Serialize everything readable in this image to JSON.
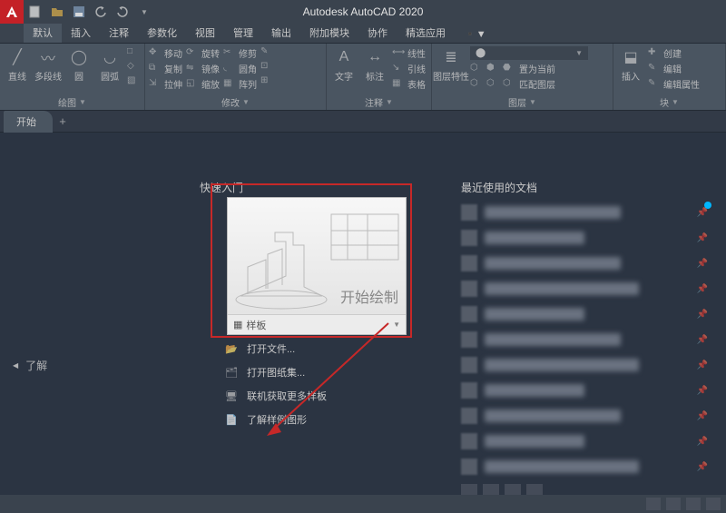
{
  "title": "Autodesk AutoCAD 2020",
  "ribbon_tabs": [
    "默认",
    "插入",
    "注释",
    "参数化",
    "视图",
    "管理",
    "输出",
    "附加模块",
    "协作",
    "精选应用"
  ],
  "active_ribbon_tab": 0,
  "panels": {
    "draw": {
      "title": "绘图",
      "btns": [
        "直线",
        "多段线",
        "圆",
        "圆弧"
      ]
    },
    "modify": {
      "title": "修改",
      "btns": [
        "移动",
        "复制",
        "拉伸"
      ],
      "small": [
        "旋转",
        "镜像",
        "缩放",
        "修剪",
        "圆角",
        "阵列"
      ]
    },
    "annotate": {
      "title": "注释",
      "btns": [
        "文字",
        "标注"
      ],
      "small": [
        "线性",
        "引线",
        "表格"
      ]
    },
    "layer": {
      "title": "图层",
      "btns": [
        "图层特性"
      ],
      "small": [
        "置为当前",
        "匹配图层"
      ]
    },
    "block": {
      "title": "块",
      "btns": [
        "插入"
      ],
      "small": [
        "创建",
        "编辑",
        "编辑属性"
      ]
    }
  },
  "doc_tab": "开始",
  "learn_nav": "了解",
  "quickstart": {
    "title": "快速入门",
    "start_draw": "开始绘制",
    "template_label": "样板",
    "links": [
      "打开文件...",
      "打开图纸集...",
      "联机获取更多样板",
      "了解样例图形"
    ]
  },
  "recent": {
    "title": "最近使用的文档",
    "count": 11
  }
}
